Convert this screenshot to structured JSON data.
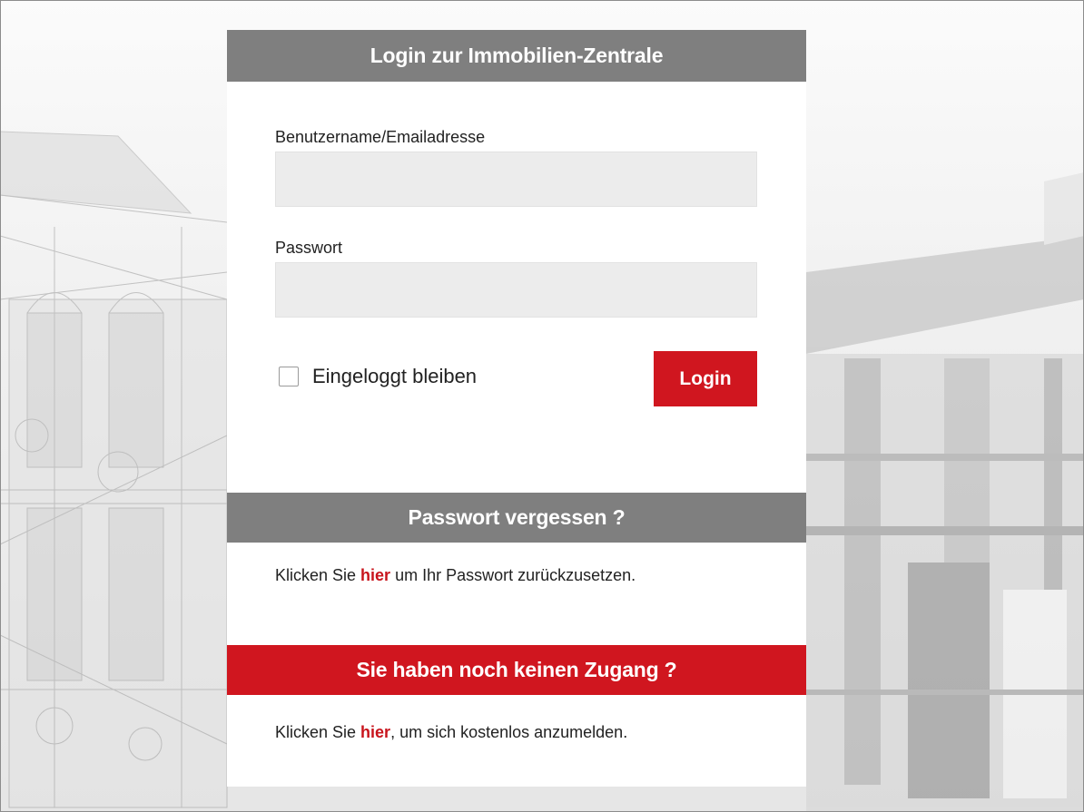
{
  "header": {
    "title": "Login zur Immobilien-Zentrale"
  },
  "form": {
    "username_label": "Benutzername/Emailadresse",
    "username_value": "",
    "password_label": "Passwort",
    "password_value": "",
    "remember_label": "Eingeloggt bleiben",
    "remember_checked": false,
    "login_button": "Login"
  },
  "forgot": {
    "title": "Passwort vergessen ?",
    "text_before": "Klicken Sie ",
    "link": "hier",
    "text_after": " um Ihr Passwort zurückzusetzen."
  },
  "register": {
    "title": "Sie haben noch keinen Zugang ?",
    "text_before": "Klicken Sie ",
    "link": "hier",
    "text_after": ", um sich kostenlos anzumelden."
  },
  "colors": {
    "accent": "#d0161f",
    "bar_gray": "#7f7f7f",
    "input_bg": "#ececec"
  }
}
